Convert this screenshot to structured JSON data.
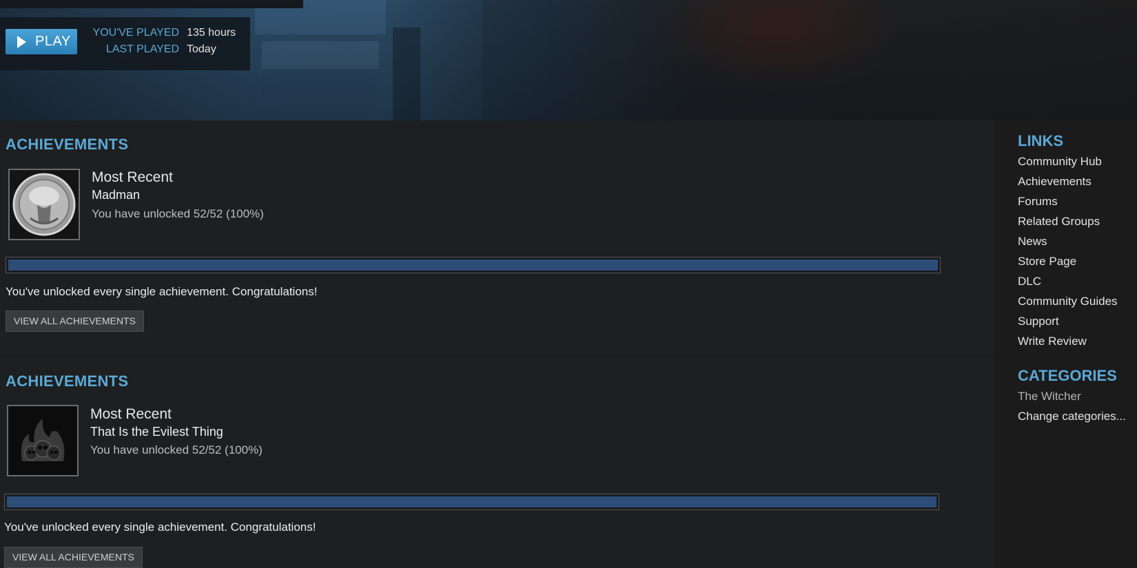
{
  "hero": {
    "play_label": "PLAY",
    "stats": [
      {
        "label": "YOU'VE PLAYED",
        "value": "135 hours"
      },
      {
        "label": "LAST PLAYED",
        "value": "Today"
      }
    ]
  },
  "achievement_panels": [
    {
      "title": "ACHIEVEMENTS",
      "recent_label": "Most Recent",
      "name": "Madman",
      "progress_text": "You have unlocked 52/52 (100%)",
      "progress_percent": 100,
      "message": "You've unlocked every single achievement.  Congratulations!",
      "button_label": "VIEW ALL ACHIEVEMENTS",
      "icon": "silver-medallion-icon"
    },
    {
      "title": "ACHIEVEMENTS",
      "recent_label": "Most Recent",
      "name": "That Is the Evilest Thing",
      "progress_text": "You have unlocked 52/52 (100%)",
      "progress_percent": 100,
      "message": "You've unlocked every single achievement.  Congratulations!",
      "button_label": "VIEW ALL ACHIEVEMENTS",
      "icon": "flaming-skulls-icon"
    }
  ],
  "sidebar": {
    "links_title": "LINKS",
    "links": [
      "Community Hub",
      "Achievements",
      "Forums",
      "Related Groups",
      "News",
      "Store Page",
      "DLC",
      "Community Guides",
      "Support",
      "Write Review"
    ],
    "categories_title": "CATEGORIES",
    "categories": [
      {
        "label": "The Witcher",
        "color": "#b4b4b4"
      },
      {
        "label": "Change categories...",
        "color": "#e3e3e3"
      }
    ]
  },
  "colors": {
    "accent": "#5aa9d6",
    "play_button": "#3d94c9",
    "progress_fill": "#2b4d78"
  }
}
